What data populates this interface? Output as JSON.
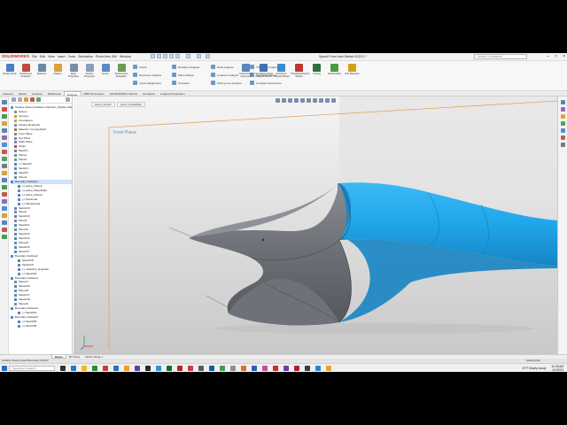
{
  "app": {
    "logo": "SOLIDWORKS",
    "menus": [
      "File",
      "Edit",
      "View",
      "Insert",
      "Tools",
      "Simulation",
      "PhotoView 360",
      "Window"
    ],
    "document_title": "Speed Form Inlet Sketch 2023.2 *",
    "search_placeholder": "Search Commands"
  },
  "ribbon": {
    "buttons": [
      {
        "label": "Design Study",
        "color": "#4a7fc0"
      },
      {
        "label": "Interference Detection",
        "color": "#c24a3a"
      },
      {
        "label": "Measure",
        "color": "#6a8aa8"
      },
      {
        "label": "Markup",
        "color": "#d9a23c"
      },
      {
        "label": "Mass Properties",
        "color": "#7a8fa3"
      },
      {
        "label": "Section Properties",
        "color": "#8ba0b6"
      },
      {
        "label": "Sensor",
        "color": "#5a8bc7"
      },
      {
        "label": "Performance Evaluation",
        "color": "#6c9a52"
      }
    ],
    "small_items": [
      "Check",
      "Geometry Analysis",
      "Import Diagnostics",
      "Deviation Analysis",
      "Zebra Stripes",
      "Curvature",
      "Draft Analysis",
      "Undercut Analysis",
      "Parting Line Analysis",
      "Thickness Analysis",
      "Symmetry Check",
      "Compare Documents"
    ],
    "right_buttons": [
      {
        "label": "Check Active Document",
        "color": "#5c87b8"
      },
      {
        "label": "SimulationXpress Analysis Wizard",
        "color": "#3f6fb5"
      },
      {
        "label": "FloXpress Analysis Wizard",
        "color": "#3d8ccc"
      },
      {
        "label": "DriveWorksXpress Wizard",
        "color": "#c0392b"
      },
      {
        "label": "Costing",
        "color": "#2f6f3a"
      },
      {
        "label": "Sustainability",
        "color": "#4c9b3f"
      },
      {
        "label": "Part Reviewer",
        "color": "#d4a017"
      }
    ]
  },
  "command_tabs": [
    "Features",
    "Sketch",
    "Surfaces",
    "Weldments",
    "Evaluate",
    "MBD Dimensions",
    "SOLIDWORKS Add-Ins",
    "Simulation",
    "Analysis Preparation"
  ],
  "active_command_tab": "Evaluate",
  "tree": [
    {
      "label": "Surface-Sweep (Default<<Default>_Display State 1>)",
      "indent": 0,
      "color": "#6b8ec2"
    },
    {
      "label": "History",
      "indent": 1,
      "color": "#8c8c8c"
    },
    {
      "label": "Sensors",
      "indent": 1,
      "color": "#d69a2d"
    },
    {
      "label": "Annotations",
      "indent": 1,
      "color": "#b9a34a"
    },
    {
      "label": "Surface Bodies(5)",
      "indent": 1,
      "color": "#7895b5"
    },
    {
      "label": "Material <not specified>",
      "indent": 1,
      "color": "#9a7a4a"
    },
    {
      "label": "Front Plane",
      "indent": 1,
      "color": "#7a8ba0"
    },
    {
      "label": "Top Plane",
      "indent": 1,
      "color": "#7a8ba0"
    },
    {
      "label": "Right Plane",
      "indent": 1,
      "color": "#7a8ba0"
    },
    {
      "label": "Origin",
      "indent": 1,
      "color": "#c94a4a"
    },
    {
      "label": "Sketch1",
      "indent": 1,
      "color": "#5f86b8"
    },
    {
      "label": "Plane1",
      "indent": 1,
      "color": "#7a8ba0"
    },
    {
      "label": "Plane2",
      "indent": 1,
      "color": "#7a8ba0"
    },
    {
      "label": "(-) Sketch3",
      "indent": 1,
      "color": "#5f86b8"
    },
    {
      "label": "Sketch4",
      "indent": 1,
      "color": "#5f86b8"
    },
    {
      "label": "Sketch5",
      "indent": 1,
      "color": "#5f86b8"
    },
    {
      "label": "Plane3",
      "indent": 1,
      "color": "#7a8ba0"
    },
    {
      "label": "Boundary-Surface1",
      "indent": 0,
      "color": "#4c8fd6",
      "selected": true
    },
    {
      "label": "(-) spline_Plane1",
      "indent": 2,
      "color": "#5f86b8"
    },
    {
      "label": "(-) spline_PlaneRight",
      "indent": 2,
      "color": "#5f86b8"
    },
    {
      "label": "(-) spline_Plane2",
      "indent": 2,
      "color": "#5f86b8"
    },
    {
      "label": "(-) Sectioned",
      "indent": 2,
      "color": "#5f86b8"
    },
    {
      "label": "(-) SplineGuide",
      "indent": 2,
      "color": "#5f86b8"
    },
    {
      "label": "Sketch18",
      "indent": 1,
      "color": "#5f86b8"
    },
    {
      "label": "Plane4",
      "indent": 1,
      "color": "#7a8ba0"
    },
    {
      "label": "Sketch20",
      "indent": 1,
      "color": "#5f86b8"
    },
    {
      "label": "Plane5",
      "indent": 1,
      "color": "#7a8ba0"
    },
    {
      "label": "Sketch21",
      "indent": 1,
      "color": "#5f86b8"
    },
    {
      "label": "Plane11",
      "indent": 1,
      "color": "#7a8ba0"
    },
    {
      "label": "Sketch23",
      "indent": 1,
      "color": "#5f86b8"
    },
    {
      "label": "Sketch24",
      "indent": 1,
      "color": "#5f86b8"
    },
    {
      "label": "Plane15",
      "indent": 1,
      "color": "#7a8ba0"
    },
    {
      "label": "Sketch26",
      "indent": 1,
      "color": "#5f86b8"
    },
    {
      "label": "Sketch27",
      "indent": 1,
      "color": "#5f86b8"
    },
    {
      "label": "Boundary-Surface2",
      "indent": 0,
      "color": "#4c8fd6"
    },
    {
      "label": "Sketch28",
      "indent": 2,
      "color": "#5f86b8"
    },
    {
      "label": "Sketch29",
      "indent": 2,
      "color": "#5f86b8"
    },
    {
      "label": "(-) midspline_Eopplate",
      "indent": 2,
      "color": "#5f86b8"
    },
    {
      "label": "(-) Sketch30",
      "indent": 2,
      "color": "#5f86b8"
    },
    {
      "label": "Boundary-Surface3",
      "indent": 0,
      "color": "#4c8fd6"
    },
    {
      "label": "Plane17",
      "indent": 1,
      "color": "#7a8ba0"
    },
    {
      "label": "Sketch36",
      "indent": 1,
      "color": "#5f86b8"
    },
    {
      "label": "Plane18",
      "indent": 1,
      "color": "#7a8ba0"
    },
    {
      "label": "Sketch47",
      "indent": 1,
      "color": "#5f86b8"
    },
    {
      "label": "Sketch48",
      "indent": 1,
      "color": "#5f86b8"
    },
    {
      "label": "Plane19",
      "indent": 1,
      "color": "#7a8ba0"
    },
    {
      "label": "Boundary-Surface4",
      "indent": 0,
      "color": "#4c8fd6"
    },
    {
      "label": "(-) Sketch54",
      "indent": 2,
      "color": "#5f86b8"
    },
    {
      "label": "Boundary-Surface5",
      "indent": 0,
      "color": "#4c8fd6"
    },
    {
      "label": "(-) Sketch55",
      "indent": 2,
      "color": "#5f86b8"
    },
    {
      "label": "(-) Sketch56",
      "indent": 2,
      "color": "#5f86b8"
    }
  ],
  "viewport": {
    "doc_tabs": [
      "spline_Plane2",
      "spline_PlaneRight"
    ],
    "plane_label": "Front Plane",
    "body_colors": {
      "gray": "#6b6e74",
      "gray_dark": "#4e5157",
      "blue": "#1fa5ea",
      "blue_dark": "#1684c3",
      "plane_edge": "#e3a35f"
    }
  },
  "bottom_tabs": [
    "Model",
    "3D Views",
    "Motion Study 1"
  ],
  "active_bottom_tab": "Model",
  "status": {
    "left": "Surface-Sweep Insert Boundary 2023.2",
    "right": "Editing Part"
  },
  "taskbar": {
    "search_placeholder": "Type here to search",
    "weather": "87°F  Mostly cloudy",
    "time": "10:36 AM",
    "date": "6/1/2023",
    "pinned_colors": [
      "#333333",
      "#1f7ad1",
      "#f2b62a",
      "#2b8a3e",
      "#d6372c",
      "#1e73c9",
      "#f09b2a",
      "#5b3fa6",
      "#2a2a2a",
      "#1f9ad6",
      "#0b6e3a",
      "#b5252b",
      "#cf3c3c",
      "#5a5a5a",
      "#0f5fa8",
      "#3ea04a",
      "#8f8f8f",
      "#df6d2a",
      "#2d5db7",
      "#c64a9e",
      "#c82d2d",
      "#6f3aa8",
      "#a81f2f",
      "#3c3c3c",
      "#1d8ed1",
      "#e8a52c"
    ]
  }
}
